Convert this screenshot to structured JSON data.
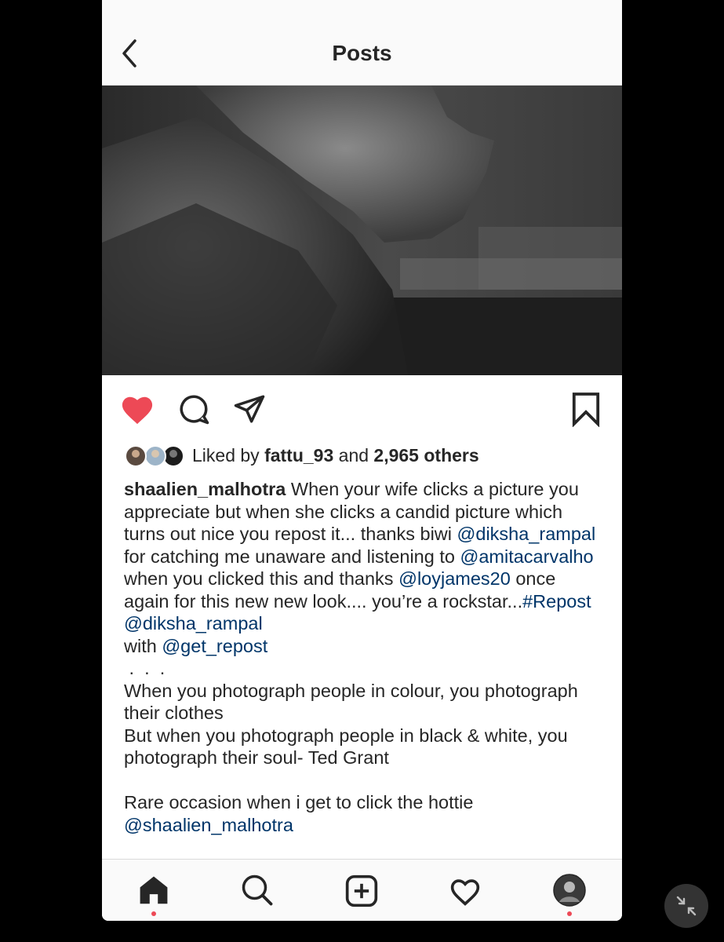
{
  "header": {
    "title": "Posts"
  },
  "post": {
    "liked": true,
    "likes": {
      "prefix": "Liked by ",
      "user": "fattu_93",
      "middle": " and ",
      "others": "2,965 others"
    },
    "caption": {
      "author": "shaalien_malhotra",
      "t1": " When your wife clicks a picture you appreciate but when she clicks a candid picture which turns out nice you repost it... thanks biwi ",
      "m1": "@diksha_rampal",
      "t2": " for catching me unaware and listening to ",
      "m2": "@amitacarvalho",
      "t3": " when you clicked this and thanks ",
      "m3": "@loyjames20",
      "t4": " once again for this new new look.... you’re a rockstar...",
      "h1": "#Repost",
      "t5": " ",
      "m4": "@diksha_rampal",
      "t6": "\nwith ",
      "m5": "@get_repost",
      "dots": "\n .  .  .",
      "quote": "\nWhen you photograph people in colour, you photograph their clothes\nBut when you photograph people in black & white, you photograph their soul- Ted Grant\n\nRare occasion when i get to click the hottie\n",
      "m6": "@shaalien_malhotra"
    }
  },
  "colors": {
    "like": "#ed4956",
    "link": "#003569",
    "text": "#262626"
  },
  "icons": [
    "back-chevron-icon",
    "heart-filled-icon",
    "comment-icon",
    "share-icon",
    "bookmark-icon",
    "home-icon",
    "search-icon",
    "add-post-icon",
    "activity-heart-icon",
    "profile-avatar-icon",
    "minimize-icon"
  ]
}
